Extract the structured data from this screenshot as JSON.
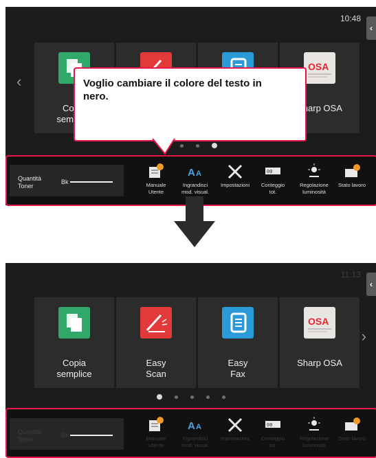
{
  "top_panel": {
    "clock": "10:48",
    "tiles": [
      {
        "label1": "Copia",
        "label2": "semplice"
      },
      {
        "label1": "",
        "label2": ""
      },
      {
        "label1": "",
        "label2": ""
      },
      {
        "label1": "Sharp OSA",
        "label2": ""
      }
    ],
    "callout": "Voglio cambiare il colore del testo in nero.",
    "dots_count": 4,
    "active_dot": 4
  },
  "bottom_panel": {
    "clock": "11:13",
    "tiles": [
      {
        "label1": "Copia",
        "label2": "semplice"
      },
      {
        "label1": "Easy",
        "label2": "Scan"
      },
      {
        "label1": "Easy",
        "label2": "Fax"
      },
      {
        "label1": "Sharp OSA",
        "label2": ""
      }
    ],
    "dots_count": 5,
    "active_dot": 1
  },
  "taskbar": {
    "toner_label": "Quantità\nToner",
    "toner_label_line1": "Quantità",
    "toner_label_line2": "Toner",
    "toner_color": "Bk",
    "items": [
      {
        "name": "manual",
        "line1": "Manuale",
        "line2": "Utente"
      },
      {
        "name": "zoom",
        "line1": "Ingrandisci",
        "line2": "mod. visual."
      },
      {
        "name": "settings",
        "line1": "Impostazioni",
        "line2": ""
      },
      {
        "name": "counter",
        "line1": "Conteggio",
        "line2": "tot."
      },
      {
        "name": "brightness",
        "line1": "Regolazione",
        "line2": "luminosità"
      },
      {
        "name": "job-status",
        "line1": "Stato lavoro",
        "line2": ""
      }
    ]
  },
  "colors": {
    "highlight": "#e8144a",
    "panel_bg": "#1c1c1c",
    "copy_icon": "#2fa86a",
    "scan_icon": "#e23a3a",
    "fax_icon": "#2a9ad8"
  },
  "icons": [
    "chevron-left-icon",
    "chevron-right-icon",
    "copy-icon",
    "scan-icon",
    "fax-icon",
    "sharp-osa-icon",
    "manual-icon",
    "zoom-icon",
    "settings-icon",
    "counter-icon",
    "brightness-icon",
    "job-status-icon",
    "down-arrow-icon"
  ]
}
